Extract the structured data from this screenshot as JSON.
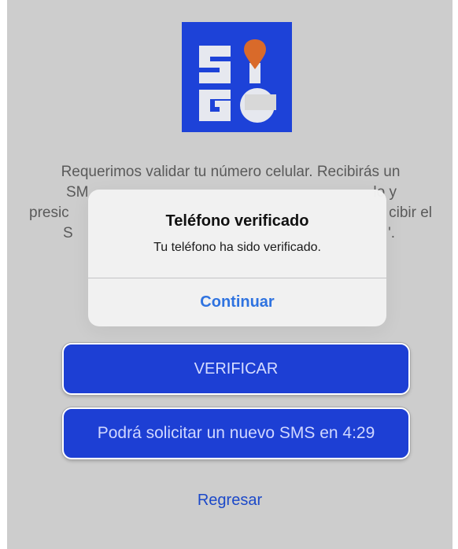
{
  "logo": {
    "letters": [
      "S",
      "I",
      "G",
      "O"
    ],
    "colors": {
      "background": "#1d42d8",
      "letters": "#e6e8ef",
      "pin": "#d96a2a"
    }
  },
  "intro": {
    "line1": "Requerimos validar tu número celular. Recibirás un",
    "line2_left": "SM",
    "line2_right": "lo y",
    "line3_left": "presic",
    "line3_right": "cibir el",
    "line4_left": "S",
    "line4_right": "'."
  },
  "buttons": {
    "verify_label": "VERIFICAR",
    "resend_label": "Podrá solicitar un nuevo SMS en 4:29",
    "back_label": "Regresar"
  },
  "alert": {
    "title": "Teléfono verificado",
    "message": "Tu teléfono ha sido verificado.",
    "action_label": "Continuar"
  },
  "colors": {
    "primary": "#1d3fd4",
    "link": "#1c49c9",
    "alert_action": "#2f73e0",
    "screen_bg": "#cdcdcd"
  }
}
